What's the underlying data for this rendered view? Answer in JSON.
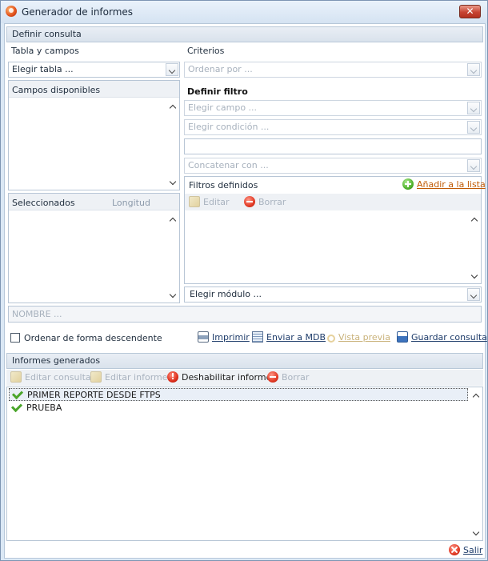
{
  "window": {
    "title": "Generador de informes",
    "close_label": "✕"
  },
  "definir_consulta": {
    "header": "Definir consulta",
    "tabla_y_campos_label": "Tabla y campos",
    "criterios_label": "Criterios",
    "elegir_tabla": "Elegir tabla ...",
    "ordenar_por": "Ordenar por ...",
    "campos_disponibles": "Campos disponibles",
    "definir_filtro": "Definir filtro",
    "elegir_campo": "Elegir campo ...",
    "elegir_condicion": "Elegir condición ...",
    "filter_value": "",
    "concatenar_con": "Concatenar con ...",
    "filtros_definidos": "Filtros definidos",
    "anadir_a_la_lista": "Añadir a la lista",
    "editar": "Editar",
    "borrar": "Borrar",
    "seleccionados": "Seleccionados",
    "longitud": "Longitud",
    "elegir_modulo": "Elegir módulo ...",
    "nombre_placeholder": "NOMBRE ...",
    "ordenar_descendente": "Ordenar de forma descendente",
    "ordenar_descendente_checked": false,
    "actions": {
      "imprimir": "Imprimir",
      "enviar_a_mdb": "Enviar a MDB",
      "vista_previa": "Vista previa",
      "guardar_consulta": "Guardar consulta"
    }
  },
  "informes_generados": {
    "header": "Informes generados",
    "toolbar": {
      "editar_consulta": "Editar consulta",
      "editar_informe": "Editar informe",
      "deshabilitar_informe": "Deshabilitar informe",
      "borrar": "Borrar"
    },
    "items": [
      {
        "label": "PRIMER REPORTE DESDE FTPS",
        "selected": true
      },
      {
        "label": "PRUEBA",
        "selected": false
      }
    ]
  },
  "footer": {
    "salir": "Salir"
  },
  "colors": {
    "accent_link": "#c05a05",
    "header_bg": "#d9e2ec",
    "window_bg": "#dbe8f5",
    "close_button": "#c74332"
  }
}
